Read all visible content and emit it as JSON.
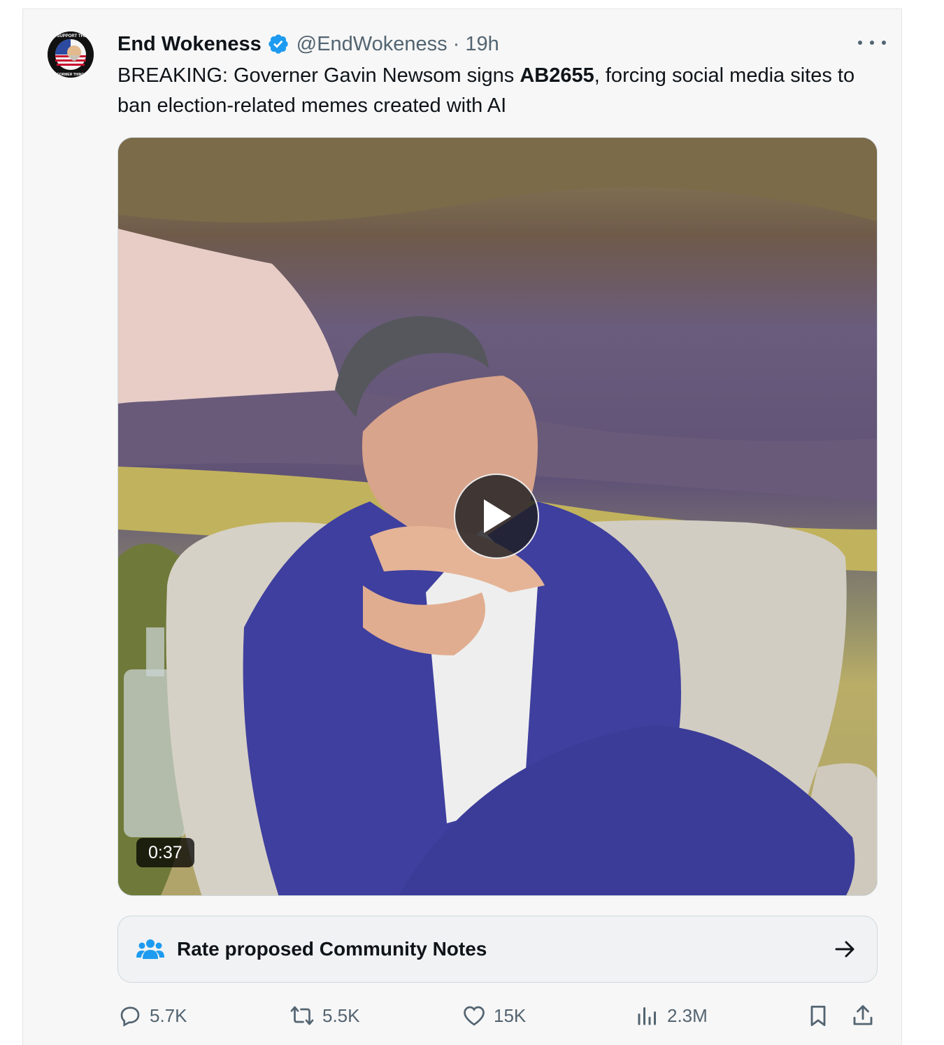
{
  "tweet": {
    "display_name": "End Wokeness",
    "handle": "@EndWokeness",
    "separator": "·",
    "time": "19h",
    "text_before": "BREAKING: Governer Gavin Newsom signs ",
    "text_bold": "AB2655",
    "text_after": ", forcing social media sites to ban election-related memes created with AI",
    "avatar_text_top": "I SUPPORT THE",
    "avatar_text_bottom": "FORMER THING",
    "video_duration": "0:37"
  },
  "community_notes": {
    "label": "Rate proposed Community Notes"
  },
  "actions": {
    "replies": "5.7K",
    "reposts": "5.5K",
    "likes": "15K",
    "views": "2.3M"
  },
  "colors": {
    "verified": "#1d9bf0",
    "notes_icon": "#1d9bf0",
    "muted": "#536471",
    "text": "#0f1419"
  }
}
